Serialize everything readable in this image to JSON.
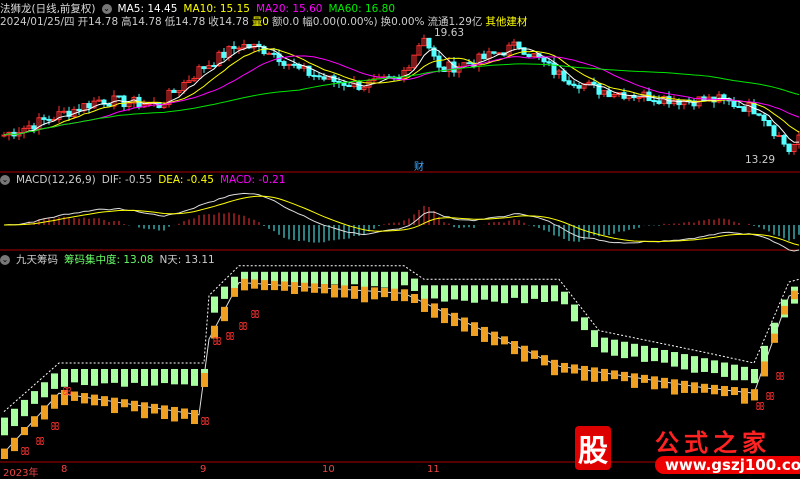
{
  "header": {
    "title": "法狮龙(日线,前复权)",
    "ma5": "MA5: 14.45",
    "ma10": "MA10: 15.15",
    "ma20": "MA20: 15.60",
    "ma60": "MA60: 16.80",
    "date": "2024/01/25/四",
    "open": "开14.78",
    "high": "高14.78",
    "low": "低14.78",
    "close": "收14.78",
    "vol": "量0",
    "amount": "额0.0",
    "amp": "幅0.00(0.00%)",
    "turnover": "换0.00%",
    "float": "流通1.29亿",
    "sector": "其他建材"
  },
  "annotations": {
    "high": "19.63",
    "low": "13.29",
    "fin": "财"
  },
  "macd": {
    "title": "MACD(12,26,9)",
    "dif": "DIF: -0.55",
    "dea": "DEA: -0.45",
    "macd": "MACD: -0.21"
  },
  "chips": {
    "title": "九天筹码",
    "conc": "筹码集中度: 13.08",
    "nday": "N天: 13.11"
  },
  "xaxis": [
    "2023年",
    "8",
    "9",
    "10",
    "11"
  ],
  "watermark": {
    "icon": "股",
    "name": "公式之家",
    "url": "www.gszj100.com"
  },
  "colors": {
    "up": "#ff3232",
    "down": "#54ffff",
    "ma5": "#ffffff",
    "ma10": "#ffff00",
    "ma20": "#ff00ff",
    "ma60": "#00e600",
    "chipUp": "#a8ffa0",
    "chipDn": "#f0a020"
  },
  "chart_data": {
    "type": "candlestick",
    "price_keypoints": [
      [
        0,
        14.45
      ],
      [
        11,
        15.45
      ],
      [
        19,
        16.21
      ],
      [
        31,
        15.96
      ],
      [
        39,
        17.72
      ],
      [
        47,
        18.98
      ],
      [
        53,
        18.72
      ],
      [
        59,
        17.72
      ],
      [
        65,
        17.21
      ],
      [
        71,
        16.96
      ],
      [
        79,
        17.21
      ],
      [
        84,
        19.48
      ],
      [
        87,
        17.72
      ],
      [
        95,
        18.22
      ],
      [
        103,
        18.98
      ],
      [
        111,
        17.47
      ],
      [
        119,
        16.71
      ],
      [
        127,
        16.46
      ],
      [
        135,
        16.21
      ],
      [
        143,
        16.21
      ],
      [
        151,
        15.7
      ],
      [
        157,
        13.69
      ],
      [
        159,
        14.2
      ]
    ],
    "ylim": [
      13.0,
      20.0
    ],
    "chip_upper": [
      [
        0,
        1.2
      ],
      [
        11,
        3.0
      ],
      [
        40,
        3.0
      ],
      [
        41,
        5.5
      ],
      [
        47,
        6.6
      ],
      [
        80,
        6.6
      ],
      [
        84,
        6.1
      ],
      [
        111,
        6.1
      ],
      [
        119,
        4.2
      ],
      [
        140,
        3.4
      ],
      [
        150,
        3.0
      ],
      [
        157,
        6.0
      ],
      [
        159,
        6.1
      ]
    ],
    "chip_lower": [
      [
        0,
        0.2
      ],
      [
        11,
        2.4
      ],
      [
        39,
        1.6
      ],
      [
        41,
        4.4
      ],
      [
        47,
        6.5
      ],
      [
        80,
        6.1
      ],
      [
        111,
        3.4
      ],
      [
        140,
        2.6
      ],
      [
        150,
        2.4
      ],
      [
        157,
        6.0
      ],
      [
        159,
        6.1
      ]
    ],
    "chip_ylim": [
      0,
      8
    ]
  }
}
